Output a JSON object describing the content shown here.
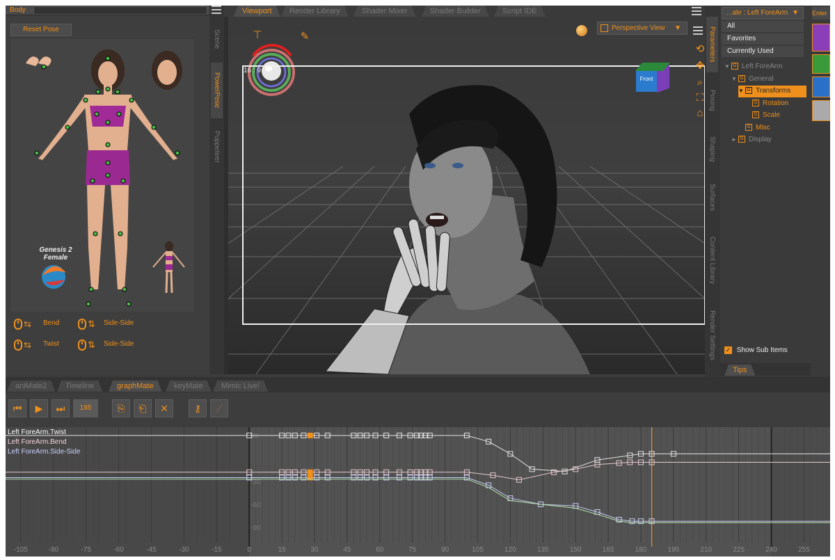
{
  "colors": {
    "accent": "#f0901c",
    "twist": "#e3e3e3",
    "bend": "#e4c8cc",
    "side_side": "#c8ccf0",
    "green_curve": "#b6e6b0",
    "current_frame": "#f0901c"
  },
  "left_panel": {
    "body_label": "Body",
    "reset_pose": "Reset Pose",
    "figure_name": "Genesis 2\nFemale",
    "controls": [
      {
        "mouse_icon": "mouse-drag-icon",
        "label": "Bend",
        "arrow_icon": "vertical-arrows-icon",
        "label2": "Side-Side"
      },
      {
        "mouse_icon": "mouse-drag-icon",
        "label": "Twist",
        "arrow_icon": "vertical-arrows-icon",
        "label2": "Side-Side"
      }
    ],
    "side_tabs": [
      "Scene",
      "PowerPose",
      "Puppeteer"
    ]
  },
  "viewport": {
    "tabs": [
      "Viewport",
      "Render Library",
      "Shader Mixer",
      "Shader Builder",
      "Script IDE"
    ],
    "active_tab": "Viewport",
    "view_mode": "Perspective View",
    "aspect": "16 : 9",
    "cube_label": "Front"
  },
  "parameters": {
    "side_tabs": [
      "Parameters",
      "Posing",
      "Shaping",
      "Surfaces",
      "Content Library",
      "Render Settings"
    ],
    "node": "...ale : Left ForeArm",
    "filters": [
      "All",
      "Favorites",
      "Currently Used"
    ],
    "tree": [
      {
        "label": "Left ForeArm",
        "indent": 0,
        "arrow": "▼",
        "dim": true
      },
      {
        "label": "General",
        "indent": 1,
        "arrow": "▼",
        "dim": true
      },
      {
        "label": "Transforms",
        "indent": 2,
        "arrow": "▼",
        "selected": true
      },
      {
        "label": "Rotation",
        "indent": 3,
        "arrow": ""
      },
      {
        "label": "Scale",
        "indent": 3,
        "arrow": ""
      },
      {
        "label": "Misc",
        "indent": 2,
        "arrow": ""
      },
      {
        "label": "Display",
        "indent": 1,
        "arrow": "►",
        "dim": true
      }
    ],
    "show_sub_items": "Show Sub Items",
    "tips": "Tips",
    "far_right_label": "Enter"
  },
  "bottom": {
    "tabs": [
      "aniMate2",
      "Timeline",
      "graphMate",
      "keyMate",
      "Mimic Live!"
    ],
    "active_tab": "graphMate",
    "frame": "185",
    "curve_labels": [
      "Left ForeArm.Twist",
      "Left ForeArm.Bend",
      "Left ForeArm.Side-Side"
    ],
    "y_labels": [
      "30",
      "-30",
      "-60",
      "-90"
    ],
    "x_ticks": [
      "-105",
      "-90",
      "-75",
      "-60",
      "-45",
      "-30",
      "-15",
      "0",
      "15",
      "30",
      "45",
      "60",
      "75",
      "90",
      "105",
      "120",
      "135",
      "150",
      "165",
      "180",
      "195",
      "210",
      "225",
      "240",
      "255"
    ]
  }
}
